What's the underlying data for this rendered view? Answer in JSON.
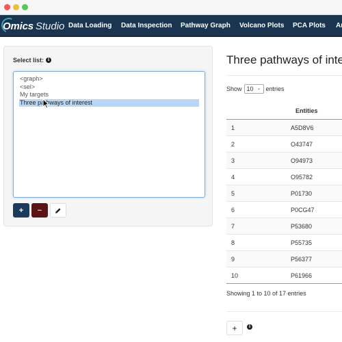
{
  "window": {
    "controls": [
      "close",
      "minimize",
      "maximize"
    ]
  },
  "navbar": {
    "brand_bold": "Omics",
    "brand_light": "Studio",
    "items": [
      {
        "label": "Data Loading"
      },
      {
        "label": "Data Inspection"
      },
      {
        "label": "Pathway Graph"
      },
      {
        "label": "Volcano Plots"
      },
      {
        "label": "PCA Plots"
      },
      {
        "label": "An"
      }
    ],
    "colors": {
      "background": "#1b3550",
      "accent": "#3ba2b8"
    }
  },
  "left_panel": {
    "label": "Select list:",
    "info_icon": "info-icon",
    "options": [
      {
        "label": "<graph>",
        "selected": false
      },
      {
        "label": "<sel>",
        "selected": false
      },
      {
        "label": "My targets",
        "selected": false
      },
      {
        "label": "Three pathways of interest",
        "selected": true
      }
    ],
    "buttons": {
      "add": "+",
      "remove": "−",
      "edit_icon": "pencil-icon"
    },
    "colors": {
      "add": "#1b3a5c",
      "remove": "#5b1313",
      "selection": "#b9d6f7"
    }
  },
  "right_panel": {
    "title": "Three pathways of interest",
    "show_label": "Show",
    "page_length": "10",
    "entries_label": "entries",
    "table": {
      "columns": [
        "",
        "Entities"
      ],
      "rows": [
        {
          "idx": "1",
          "entity": "A5D8V6"
        },
        {
          "idx": "2",
          "entity": "O43747"
        },
        {
          "idx": "3",
          "entity": "O94973"
        },
        {
          "idx": "4",
          "entity": "O95782"
        },
        {
          "idx": "5",
          "entity": "P01730"
        },
        {
          "idx": "6",
          "entity": "P0CG47"
        },
        {
          "idx": "7",
          "entity": "P53680"
        },
        {
          "idx": "8",
          "entity": "P55735"
        },
        {
          "idx": "9",
          "entity": "P56377"
        },
        {
          "idx": "10",
          "entity": "P61966"
        }
      ]
    },
    "info": "Showing 1 to 10 of 17 entries",
    "add_button": "+"
  }
}
